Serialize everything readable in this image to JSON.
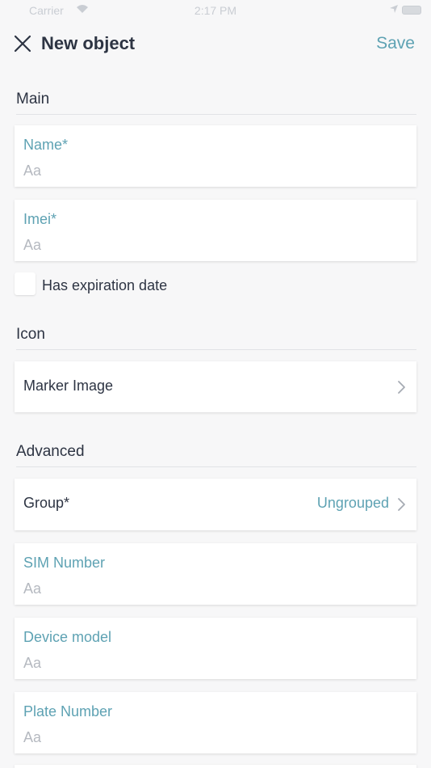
{
  "statusbar": {
    "carrier": "Carrier",
    "time": "2:17 PM"
  },
  "nav": {
    "title": "New object",
    "save_label": "Save"
  },
  "sections": {
    "main": "Main",
    "icon": "Icon",
    "advanced": "Advanced"
  },
  "fields": {
    "name": {
      "label": "Name*",
      "placeholder": "Aa",
      "value": ""
    },
    "imei": {
      "label": "Imei*",
      "placeholder": "Aa",
      "value": ""
    },
    "sim_number": {
      "label": "SIM Number",
      "placeholder": "Aa",
      "value": ""
    },
    "device_model": {
      "label": "Device model",
      "placeholder": "Aa",
      "value": ""
    },
    "plate_number": {
      "label": "Plate Number",
      "placeholder": "Aa",
      "value": ""
    }
  },
  "expiration": {
    "label": "Has expiration date",
    "checked": false
  },
  "marker_image": {
    "label": "Marker Image"
  },
  "group": {
    "label": "Group*",
    "value": "Ungrouped"
  },
  "colors": {
    "accent": "#5ea2b3",
    "text": "#2d3443",
    "placeholder": "#b5b9c0",
    "background": "#f7f7f8"
  }
}
